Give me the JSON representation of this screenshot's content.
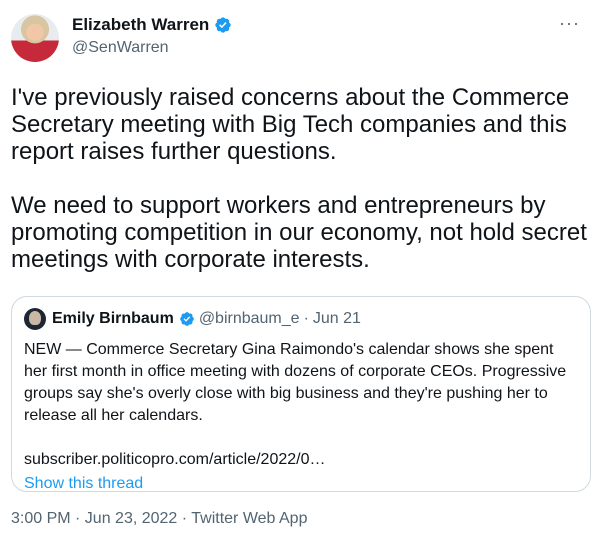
{
  "author": {
    "name": "Elizabeth Warren",
    "handle": "@SenWarren",
    "verified": true
  },
  "more_menu": "···",
  "tweet": {
    "text": "I've previously raised concerns about the Commerce Secretary meeting with Big Tech companies and this report raises further questions.\n\nWe need to support workers and entrepreneurs by promoting competition in our economy, not hold secret meetings with corporate interests."
  },
  "quote": {
    "name": "Emily Birnbaum",
    "handle": "@birnbaum_e",
    "separator": "·",
    "date": "Jun 21",
    "text": "NEW — Commerce Secretary Gina Raimondo's calendar shows she spent her first month in office meeting with dozens of corporate CEOs. Progressive groups say she's overly close with big business and they're pushing her to release all her calendars.",
    "link": "subscriber.politicopro.com/article/2022/0…",
    "show_thread": "Show this thread"
  },
  "footer": {
    "timestamp": "3:00 PM · Jun 23, 2022 · Twitter Web App"
  },
  "colors": {
    "verified": "#1d9bf0",
    "link": "#1d9bf0",
    "muted": "#536471",
    "border": "#cfd9de"
  }
}
